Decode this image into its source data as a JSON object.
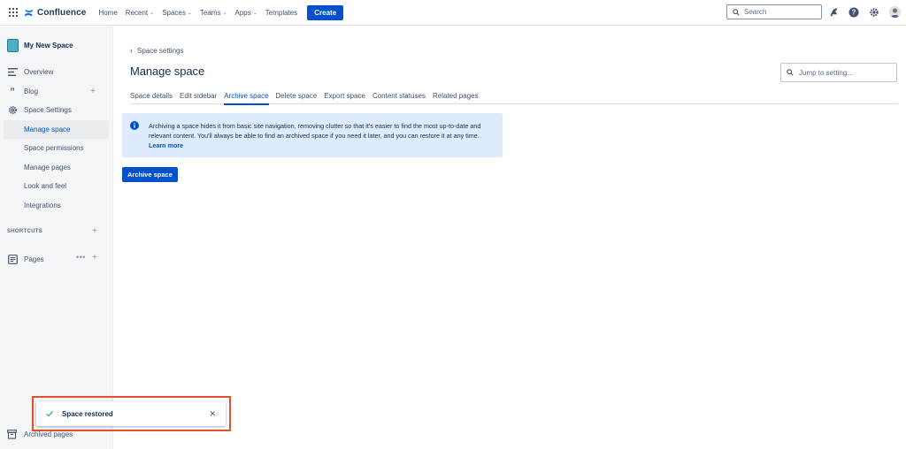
{
  "topnav": {
    "app_name": "Confluence",
    "items": [
      {
        "label": "Home",
        "has_menu": false
      },
      {
        "label": "Recent",
        "has_menu": true
      },
      {
        "label": "Spaces",
        "has_menu": true
      },
      {
        "label": "Teams",
        "has_menu": true
      },
      {
        "label": "Apps",
        "has_menu": true
      },
      {
        "label": "Templates",
        "has_menu": false
      }
    ],
    "create_label": "Create",
    "search_placeholder": "Search",
    "icons": [
      "app-switcher-icon",
      "notifications-icon",
      "help-icon",
      "settings-icon",
      "avatar"
    ],
    "accent": "#0052cc"
  },
  "sidebar": {
    "space_name": "My New Space",
    "items": [
      {
        "label": "Overview",
        "icon": "overview-icon"
      },
      {
        "label": "Blog",
        "icon": "quote-icon"
      },
      {
        "label": "Space Settings",
        "icon": "gear-icon"
      }
    ],
    "sub_items": [
      {
        "label": "Manage space",
        "active": true
      },
      {
        "label": "Space permissions",
        "active": false
      },
      {
        "label": "Manage pages",
        "active": false
      },
      {
        "label": "Look and feel",
        "active": false
      },
      {
        "label": "Integrations",
        "active": false
      }
    ],
    "shortcuts_label": "SHORTCUTS",
    "pages_label": "Pages",
    "archived_label": "Archived pages"
  },
  "main": {
    "breadcrumb": "Space settings",
    "title": "Manage space",
    "jump_placeholder": "Jump to setting...",
    "tabs": [
      {
        "label": "Space details",
        "active": false
      },
      {
        "label": "Edit sidebar",
        "active": false
      },
      {
        "label": "Archive space",
        "active": true
      },
      {
        "label": "Delete space",
        "active": false
      },
      {
        "label": "Export space",
        "active": false
      },
      {
        "label": "Content statuses",
        "active": false
      },
      {
        "label": "Related pages",
        "active": false
      }
    ],
    "info_text": "Archiving a space hides it from basic site navigation, removing clutter so that it's easier to find the most up-to-date and relevant content. You'll always be able to find an archived space if you need it later, and you can restore it at any time.",
    "info_link": "Learn more",
    "archive_button": "Archive space"
  },
  "toast": {
    "message": "Space restored",
    "highlight_color": "#e34f2f"
  }
}
